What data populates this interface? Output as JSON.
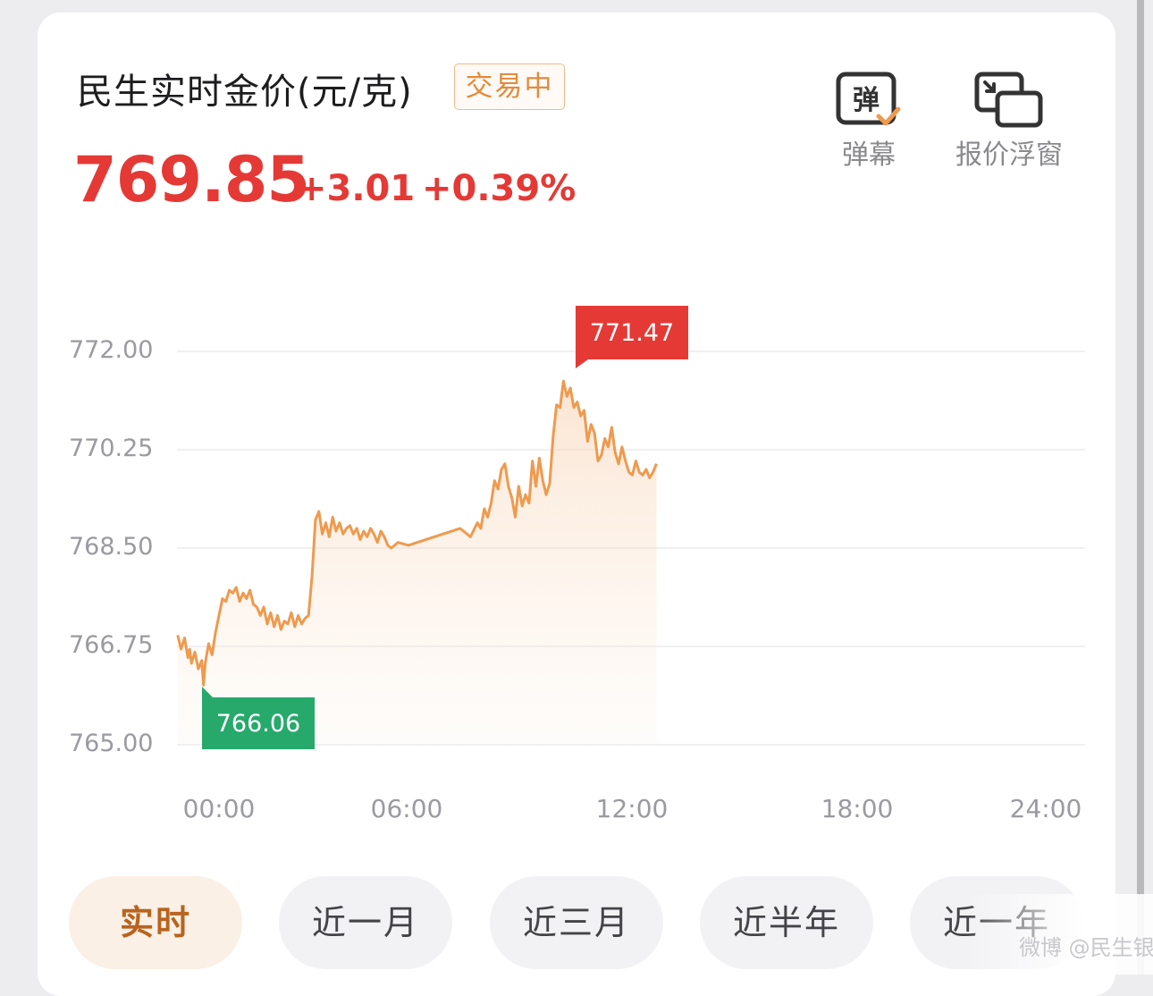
{
  "header": {
    "title": "民生实时金价(元/克)",
    "status": "交易中",
    "price": "769.85",
    "change_abs": "+3.01",
    "change_pct": "+0.39%"
  },
  "tools": {
    "danmu_label": "弹幕",
    "danmu_icon_text": "弹",
    "float_label": "报价浮窗"
  },
  "colors": {
    "up": "#e53935",
    "down": "#27a96c",
    "line": "#ee9a4f",
    "accent": "#e38a3c"
  },
  "chart_data": {
    "type": "area",
    "ylim": [
      765.0,
      772.0
    ],
    "y_ticks": [
      "772.00",
      "770.25",
      "768.50",
      "766.75",
      "765.00"
    ],
    "x_ticks": [
      "00:00",
      "06:00",
      "12:00",
      "18:00",
      "24:00"
    ],
    "x_range_hours": [
      0,
      24
    ],
    "high": {
      "label": "771.47",
      "hour": 10.3,
      "value": 771.47
    },
    "low": {
      "label": "766.06",
      "hour": 0.5,
      "value": 766.06
    },
    "series": [
      {
        "x": [
          -1.2,
          -1.1,
          -1.0,
          -0.9,
          -0.85,
          -0.8,
          -0.7,
          -0.6,
          -0.5,
          -0.45,
          -0.4,
          -0.3,
          -0.2,
          -0.1,
          0.0,
          0.1,
          0.2,
          0.3,
          0.4,
          0.5,
          0.6,
          0.7,
          0.8,
          0.9,
          1.0,
          1.1,
          1.2,
          1.3,
          1.4,
          1.5,
          1.6,
          1.7,
          1.8,
          1.9,
          2.0,
          2.1,
          2.2,
          2.3,
          2.4,
          2.5,
          2.6,
          2.7,
          2.8,
          2.9,
          3.0,
          3.1,
          3.2,
          3.3,
          3.4,
          3.5,
          3.6,
          3.7,
          3.8,
          3.9,
          4.0,
          4.1,
          4.2,
          4.3,
          4.4,
          4.5,
          4.6,
          4.7,
          4.8,
          4.9,
          5.0,
          5.2,
          5.5,
          6.0,
          6.5,
          7.0,
          7.3,
          7.5,
          7.6,
          7.7,
          7.8,
          7.9,
          8.0,
          8.1,
          8.2,
          8.3,
          8.4,
          8.5,
          8.6,
          8.7,
          8.8,
          8.9,
          9.0,
          9.1,
          9.2,
          9.3,
          9.4,
          9.5,
          9.6,
          9.7,
          9.8,
          9.9,
          10.0,
          10.1,
          10.2,
          10.3,
          10.4,
          10.5,
          10.6,
          10.7,
          10.8,
          10.9,
          11.0,
          11.1,
          11.2,
          11.3,
          11.4,
          11.5,
          11.6,
          11.7,
          11.8,
          11.9,
          12.0,
          12.1,
          12.2,
          12.3,
          12.4,
          12.5,
          12.6,
          12.7
        ],
        "values": [
          766.95,
          766.7,
          766.9,
          766.55,
          766.7,
          766.45,
          766.65,
          766.35,
          766.5,
          766.06,
          766.45,
          766.8,
          766.6,
          767.0,
          767.3,
          767.6,
          767.55,
          767.75,
          767.7,
          767.8,
          767.55,
          767.7,
          767.6,
          767.75,
          767.5,
          767.45,
          767.3,
          767.45,
          767.15,
          767.35,
          767.1,
          767.3,
          767.05,
          767.2,
          767.15,
          767.35,
          767.1,
          767.3,
          767.15,
          767.25,
          767.3,
          768.0,
          769.0,
          769.15,
          768.75,
          768.95,
          768.7,
          769.05,
          768.8,
          768.95,
          768.75,
          768.85,
          768.9,
          768.75,
          768.85,
          768.65,
          768.8,
          768.7,
          768.85,
          768.75,
          768.6,
          768.8,
          768.7,
          768.55,
          768.5,
          768.6,
          768.55,
          768.65,
          768.75,
          768.85,
          768.7,
          768.95,
          768.85,
          769.2,
          769.05,
          769.3,
          769.7,
          769.55,
          769.9,
          770.0,
          769.6,
          769.4,
          769.05,
          769.6,
          769.25,
          769.45,
          769.3,
          770.05,
          769.6,
          770.1,
          769.7,
          769.45,
          769.65,
          770.5,
          771.05,
          771.0,
          771.47,
          771.2,
          771.35,
          771.0,
          771.1,
          770.85,
          770.95,
          770.4,
          770.7,
          770.55,
          770.05,
          770.15,
          770.45,
          770.3,
          770.65,
          770.2,
          770.0,
          770.3,
          770.05,
          769.85,
          769.8,
          770.05,
          769.85,
          769.8,
          769.9,
          769.75,
          769.85,
          770.0
        ]
      }
    ]
  },
  "ranges": {
    "tabs": [
      "实时",
      "近一月",
      "近三月",
      "近半年",
      "近一年"
    ],
    "active": 0
  },
  "watermark": "微博 @民生银行"
}
